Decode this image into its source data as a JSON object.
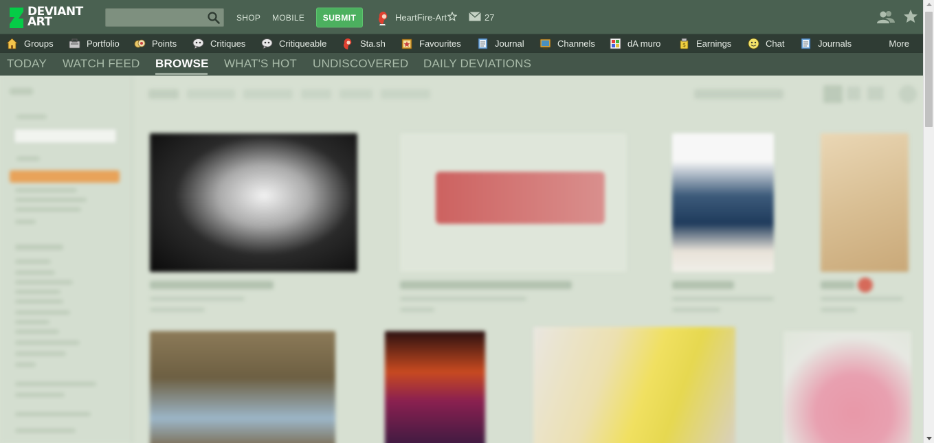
{
  "header": {
    "logo_line1": "DEVIANT",
    "logo_line2": "ART",
    "search_placeholder": "",
    "shop_label": "SHOP",
    "mobile_label": "MOBILE",
    "submit_label": "SUBMIT",
    "username": "HeartFire-Art",
    "mail_count": "27"
  },
  "nav": {
    "items": [
      {
        "label": "Groups",
        "icon": "home-icon"
      },
      {
        "label": "Portfolio",
        "icon": "portfolio-icon"
      },
      {
        "label": "Points",
        "icon": "points-icon"
      },
      {
        "label": "Critiques",
        "icon": "critiques-icon"
      },
      {
        "label": "Critiqueable",
        "icon": "critiqueable-icon"
      },
      {
        "label": "Sta.sh",
        "icon": "stash-icon"
      },
      {
        "label": "Favourites",
        "icon": "favourites-icon"
      },
      {
        "label": "Journal",
        "icon": "journal-icon"
      },
      {
        "label": "Channels",
        "icon": "channels-icon"
      },
      {
        "label": "dA muro",
        "icon": "damuro-icon"
      },
      {
        "label": "Earnings",
        "icon": "earnings-icon"
      },
      {
        "label": "Chat",
        "icon": "chat-icon"
      },
      {
        "label": "Journals",
        "icon": "journals-icon"
      }
    ],
    "more_label": "More"
  },
  "tabs": [
    {
      "label": "TODAY",
      "active": false
    },
    {
      "label": "WATCH FEED",
      "active": false
    },
    {
      "label": "BROWSE",
      "active": true
    },
    {
      "label": "WHAT'S HOT",
      "active": false
    },
    {
      "label": "UNDISCOVERED",
      "active": false
    },
    {
      "label": "DAILY DEVIATIONS",
      "active": false
    }
  ],
  "colors": {
    "header_bg": "#4a6151",
    "nav_bg": "#2f3c34",
    "tabs_bg": "#44564a",
    "submit_green": "#4cb05f",
    "content_bg": "#d7e0d2",
    "sidebar_active": "#e8a35a"
  }
}
